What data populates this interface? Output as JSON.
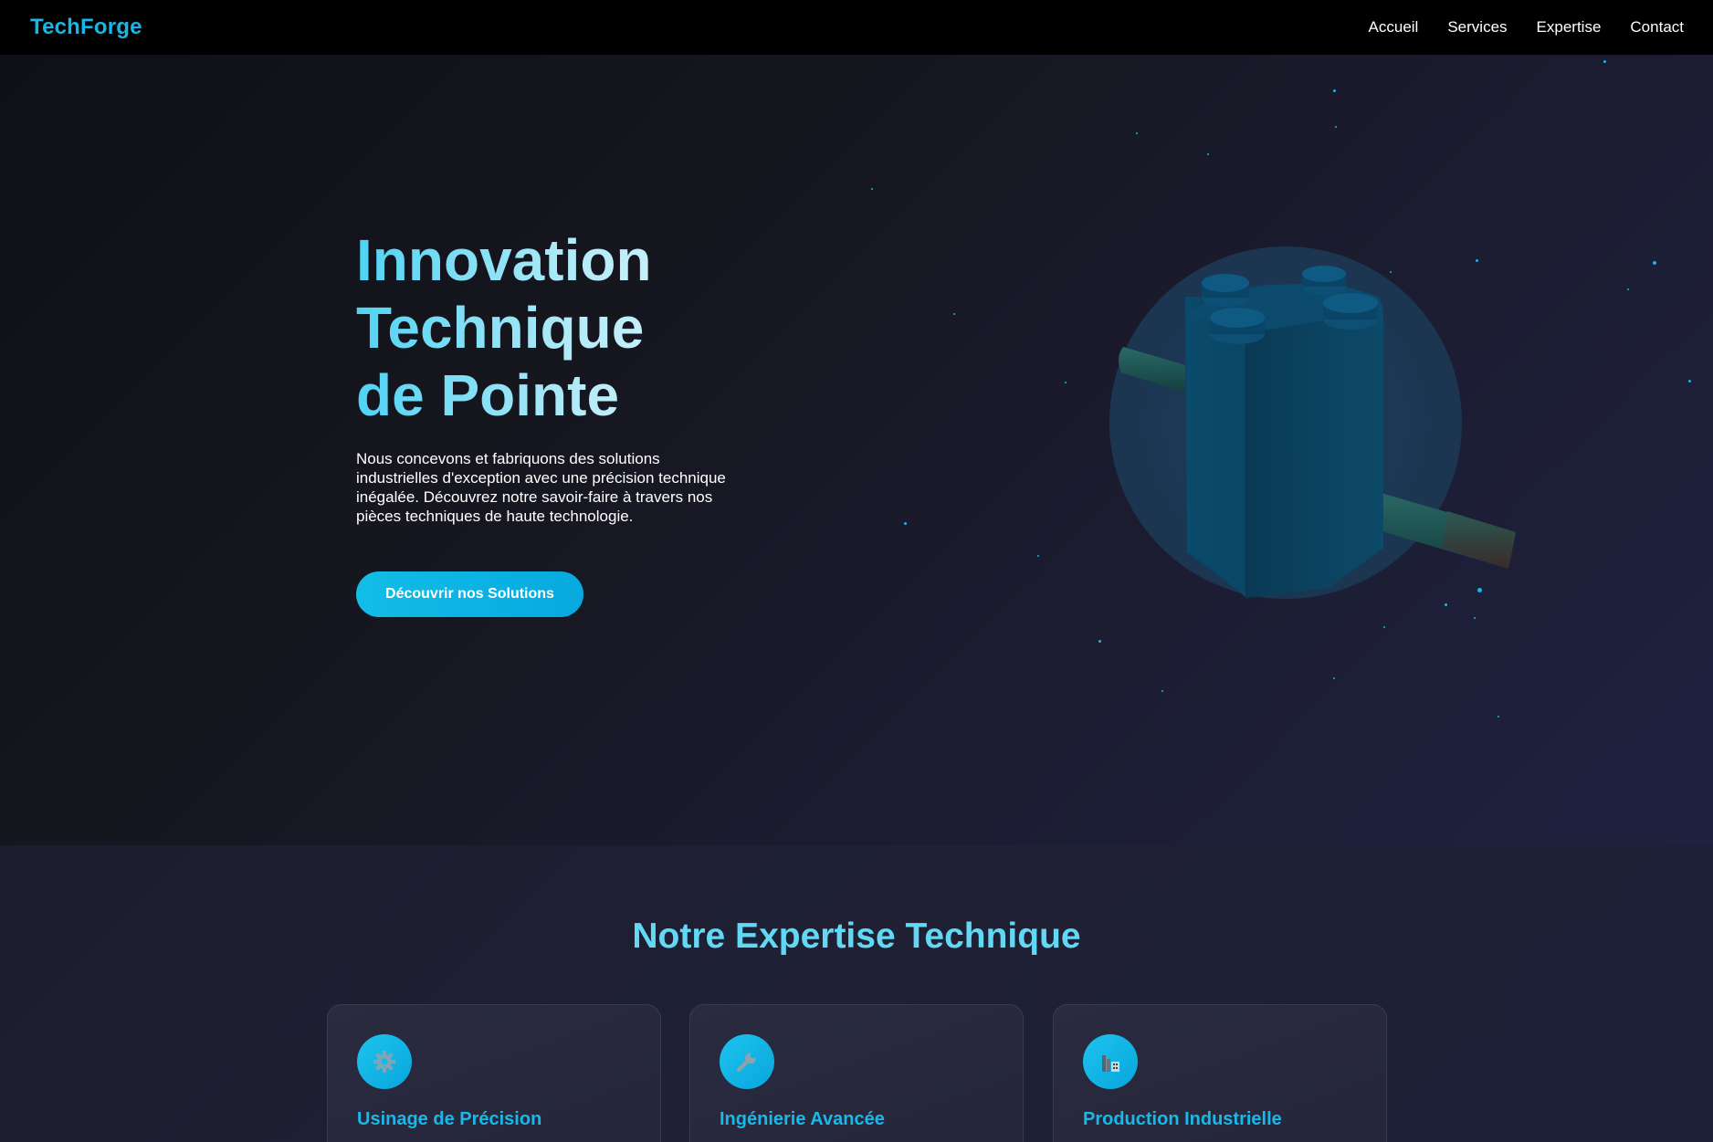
{
  "nav": {
    "logo": "TechForge",
    "links": [
      "Accueil",
      "Services",
      "Expertise",
      "Contact"
    ]
  },
  "hero": {
    "title_lines": [
      "Innovation",
      "Technique",
      "de Pointe"
    ],
    "description": "Nous concevons et fabriquons des solutions industrielles d'exception avec une précision technique inégalée. Découvrez notre savoir-faire à travers nos pièces techniques de haute technologie.",
    "cta_label": "Découvrir nos Solutions"
  },
  "expertise": {
    "title": "Notre Expertise Technique",
    "cards": [
      {
        "icon": "gear-icon",
        "title": "Usinage de Précision"
      },
      {
        "icon": "wrench-icon",
        "title": "Ingénierie Avancée"
      },
      {
        "icon": "factory-icon",
        "title": "Production Industrielle"
      }
    ]
  },
  "colors": {
    "accent": "#16b6e6",
    "nav_bg": "#000000",
    "hero_bg": "#16161f",
    "section_bg": "#1f2034"
  }
}
